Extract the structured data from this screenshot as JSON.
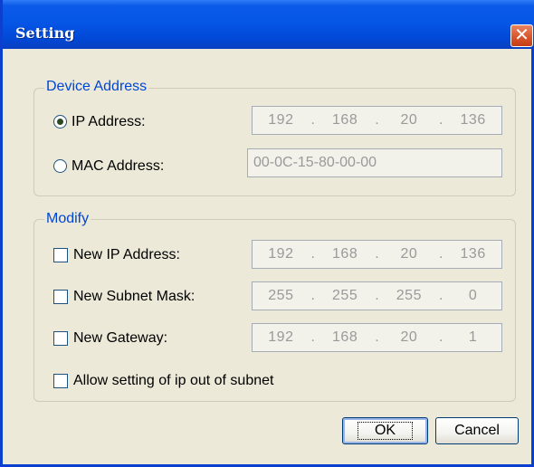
{
  "window": {
    "title": "Setting",
    "close_glyph": "✕",
    "close_icon": "close-icon"
  },
  "device_address": {
    "legend": "Device Address",
    "ip_option": {
      "label": "IP Address:",
      "selected": true,
      "octets": [
        "192",
        "168",
        "20",
        "136"
      ]
    },
    "mac_option": {
      "label": "MAC Address:",
      "selected": false,
      "value": "00-0C-15-80-00-00"
    }
  },
  "modify": {
    "legend": "Modify",
    "new_ip": {
      "label": "New IP Address:",
      "checked": false,
      "octets": [
        "192",
        "168",
        "20",
        "136"
      ]
    },
    "new_subnet": {
      "label": "New Subnet Mask:",
      "checked": false,
      "octets": [
        "255",
        "255",
        "255",
        "0"
      ]
    },
    "new_gateway": {
      "label": "New Gateway:",
      "checked": false,
      "octets": [
        "192",
        "168",
        "20",
        "1"
      ]
    },
    "allow_out_of_subnet": {
      "label": "Allow setting of ip out of subnet",
      "checked": false
    }
  },
  "buttons": {
    "ok_label": "OK",
    "cancel_label": "Cancel"
  },
  "colors": {
    "title_blue": "#0656e6",
    "group_label": "#0046d5",
    "dialog_bg": "#ece9d8",
    "close_red": "#d8532a"
  }
}
